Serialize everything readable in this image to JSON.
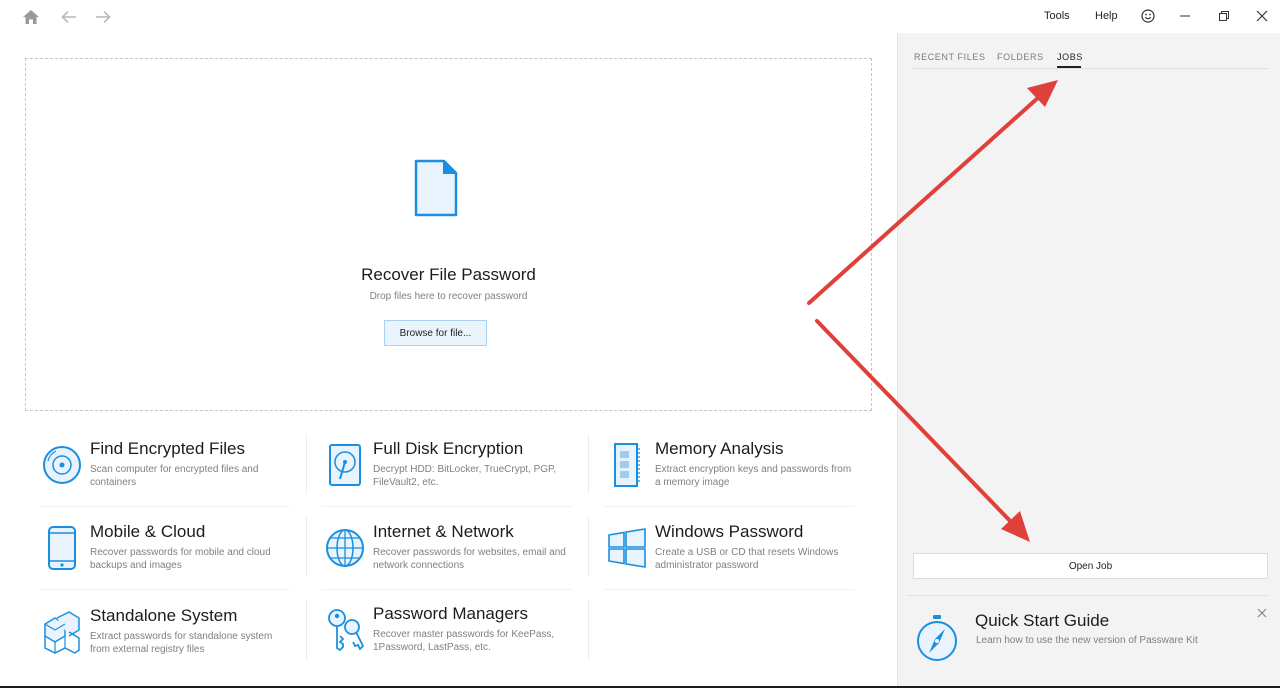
{
  "titlebar": {
    "menu": {
      "tools": "Tools",
      "help": "Help"
    },
    "icons": [
      "home-icon",
      "back-arrow-icon",
      "forward-arrow-icon",
      "smiley-icon",
      "minimize-icon",
      "restore-icon",
      "close-icon"
    ]
  },
  "dropzone": {
    "title": "Recover File Password",
    "subtitle": "Drop files here to recover password",
    "browse_label": "Browse for file..."
  },
  "tiles": [
    {
      "title": "Find Encrypted Files",
      "desc": "Scan computer for encrypted files and containers",
      "icon": "disc-scan-icon"
    },
    {
      "title": "Full Disk Encryption",
      "desc": "Decrypt HDD: BitLocker, TrueCrypt, PGP, FileVault2, etc.",
      "icon": "hard-disk-icon"
    },
    {
      "title": "Memory Analysis",
      "desc": "Extract encryption keys and passwords from a memory image",
      "icon": "memory-stick-icon"
    },
    {
      "title": "Mobile & Cloud",
      "desc": "Recover passwords for mobile and cloud backups and images",
      "icon": "mobile-phone-icon"
    },
    {
      "title": "Internet & Network",
      "desc": "Recover passwords for websites, email and network connections",
      "icon": "globe-icon"
    },
    {
      "title": "Windows Password",
      "desc": "Create a USB or CD that resets Windows administrator password",
      "icon": "windows-logo-icon"
    },
    {
      "title": "Standalone System",
      "desc": "Extract passwords for standalone system from external registry files",
      "icon": "cubes-icon"
    },
    {
      "title": "Password Managers",
      "desc": "Recover master passwords for KeePass, 1Password, LastPass, etc.",
      "icon": "keys-icon"
    }
  ],
  "right_panel": {
    "tabs": [
      "RECENT FILES",
      "FOLDERS",
      "JOBS"
    ],
    "active_tab": "JOBS",
    "open_job_label": "Open Job",
    "quick_start": {
      "title": "Quick Start Guide",
      "subtitle": "Learn how to use the new version of Passware Kit"
    }
  },
  "colors": {
    "accent_blue": "#1a8fe0",
    "annotation_red": "#e0403a",
    "panel_bg": "#f3f3f3"
  }
}
